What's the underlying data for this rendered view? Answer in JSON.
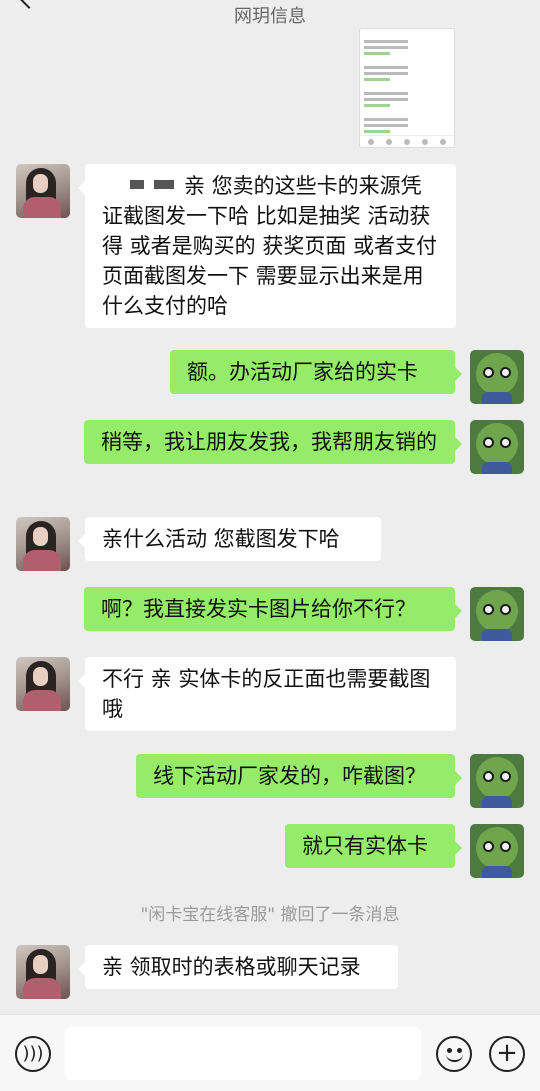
{
  "header": {
    "title": "网玥信息"
  },
  "messages": [
    {
      "side": "left",
      "text": "亲  您卖的这些卡的来源凭证截图发一下哈  比如是抽奖  活动获得  或者是购买的   获奖页面  或者支付页面截图发一下    需要显示出来是用什么支付的哈"
    },
    {
      "side": "right",
      "text": "额。办活动厂家给的实卡"
    },
    {
      "side": "right",
      "text": "稍等，我让朋友发我，我帮朋友销的"
    },
    {
      "side": "left",
      "text": "亲什么活动  您截图发下哈"
    },
    {
      "side": "right",
      "text": "啊？我直接发实卡图片给你不行？"
    },
    {
      "side": "left",
      "text": "不行 亲  实体卡的反正面也需要截图哦"
    },
    {
      "side": "right",
      "text": "线下活动厂家发的，咋截图？"
    },
    {
      "side": "right",
      "text": "就只有实体卡"
    },
    {
      "side": "left",
      "text": "亲 领取时的表格或聊天记录"
    }
  ],
  "system_notice": "\"闲卡宝在线客服\" 撤回了一条消息",
  "bottom_bar": {
    "input_value": "",
    "input_placeholder": ""
  },
  "icons": {
    "back": "chevron-left-icon",
    "voice": "voice-icon",
    "emoji": "emoji-icon",
    "plus": "plus-icon"
  },
  "colors": {
    "background": "#ededed",
    "bubble_self": "#95ec69",
    "bubble_other": "#ffffff",
    "system_text": "#9a9a9a"
  }
}
